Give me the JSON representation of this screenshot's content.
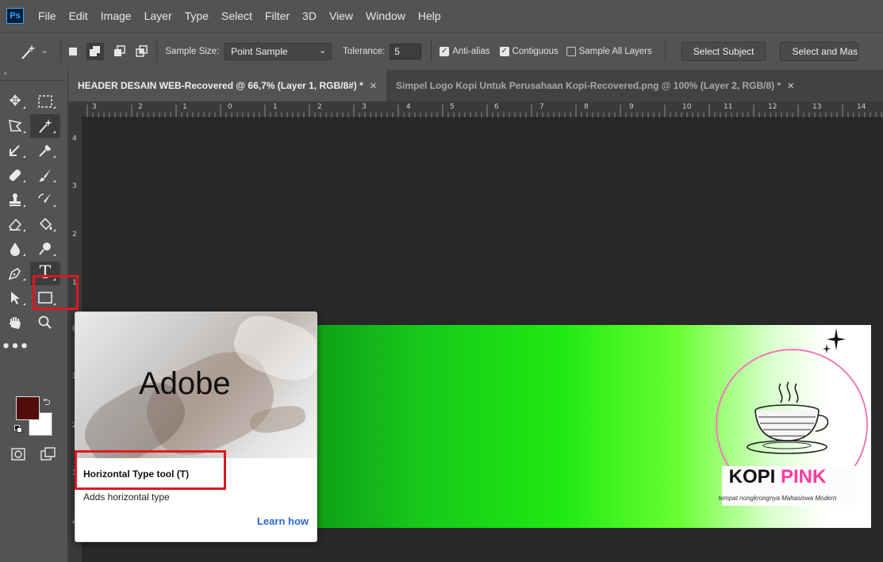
{
  "menubar": {
    "logo": "Ps",
    "items": [
      "File",
      "Edit",
      "Image",
      "Layer",
      "Type",
      "Select",
      "Filter",
      "3D",
      "View",
      "Window",
      "Help"
    ]
  },
  "options": {
    "tool_icon": "magic-wand-icon",
    "sample_size_label": "Sample Size:",
    "sample_size_value": "Point Sample",
    "tolerance_label": "Tolerance:",
    "tolerance_value": "5",
    "anti_alias_label": "Anti-alias",
    "anti_alias_checked": true,
    "contiguous_label": "Contiguous",
    "contiguous_checked": true,
    "sample_all_layers_label": "Sample All Layers",
    "sample_all_layers_checked": false,
    "select_subject_label": "Select Subject",
    "select_and_mask_label": "Select and Mas"
  },
  "tabs": [
    {
      "label": "HEADER DESAIN WEB-Recovered @ 66,7% (Layer 1, RGB/8#) *",
      "active": true
    },
    {
      "label": "Simpel Logo Kopi Untuk Perusahaan Kopi-Recovered.png @ 100% (Layer 2, RGB/8) *",
      "active": false
    }
  ],
  "ruler_top": [
    "3",
    "2",
    "1",
    "0",
    "1",
    "2",
    "3",
    "4",
    "5",
    "6",
    "7",
    "8",
    "9",
    "10",
    "11",
    "12",
    "13",
    "14"
  ],
  "ruler_left": [
    "4",
    "3",
    "2",
    "1",
    "0",
    "1",
    "2",
    "3",
    "4"
  ],
  "tooltip": {
    "media_text": "Adobe",
    "title": "Horizontal Type tool (T)",
    "description": "Adds horizontal type",
    "link": "Learn how"
  },
  "banner": {
    "brand_a": "KOPI",
    "brand_b": "PINK",
    "tagline": "tempat nongkrongnya Mahasiswa Modern"
  },
  "colors": {
    "foreground": "#520c0c",
    "background": "#ffffff",
    "highlight": "#e0161f",
    "accent_link": "#2a6ad8",
    "brand_pink": "#ff3aa2"
  }
}
